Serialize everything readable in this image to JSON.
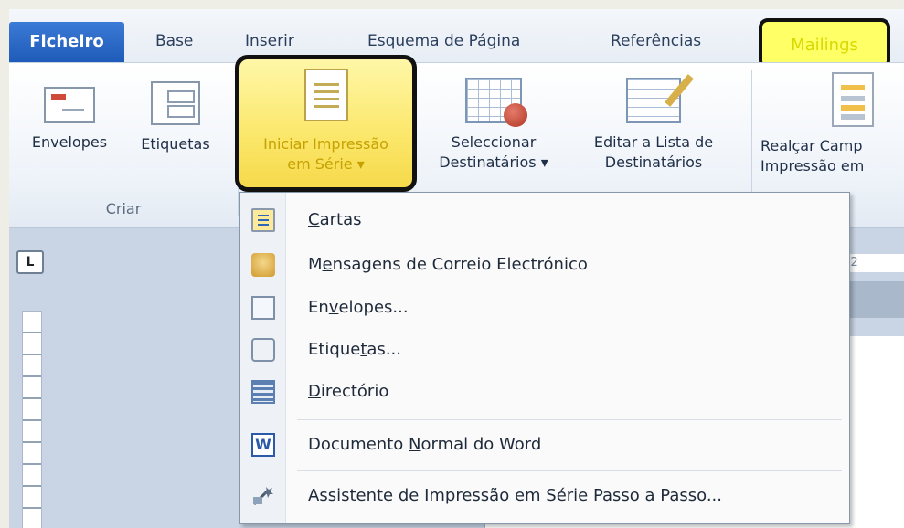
{
  "tabs": {
    "file": "Ficheiro",
    "base": "Base",
    "insert": "Inserir",
    "layout": "Esquema de Página",
    "references": "Referências",
    "mailings": "Mailings"
  },
  "ribbon": {
    "envelopes": "Envelopes",
    "labels": "Etiquetas",
    "start_merge_line1": "Iniciar Impressão",
    "start_merge_line2": "em Série ▾",
    "select_recipients_line1": "Seleccionar",
    "select_recipients_line2": "Destinatários ▾",
    "edit_list_line1": "Editar a Lista de",
    "edit_list_line2": "Destinatários",
    "highlight_line1": "Realçar Camp",
    "highlight_line2": "Impressão em",
    "group_create": "Criar"
  },
  "ruler": {
    "corner": "L",
    "h_fragment": "· · 2"
  },
  "menu": {
    "items": [
      {
        "pre": "",
        "ul": "C",
        "post": "artas"
      },
      {
        "pre": "M",
        "ul": "e",
        "post": "nsagens de Correio Electrónico"
      },
      {
        "pre": "En",
        "ul": "v",
        "post": "elopes..."
      },
      {
        "pre": "Etique",
        "ul": "t",
        "post": "as..."
      },
      {
        "pre": "",
        "ul": "D",
        "post": "irectório"
      },
      {
        "pre": "Documento ",
        "ul": "N",
        "post": "ormal do Word"
      },
      {
        "pre": "Assis",
        "ul": "t",
        "post": "ente de Impressão em Série Passo a Passo..."
      }
    ],
    "word_icon_letter": "W"
  }
}
